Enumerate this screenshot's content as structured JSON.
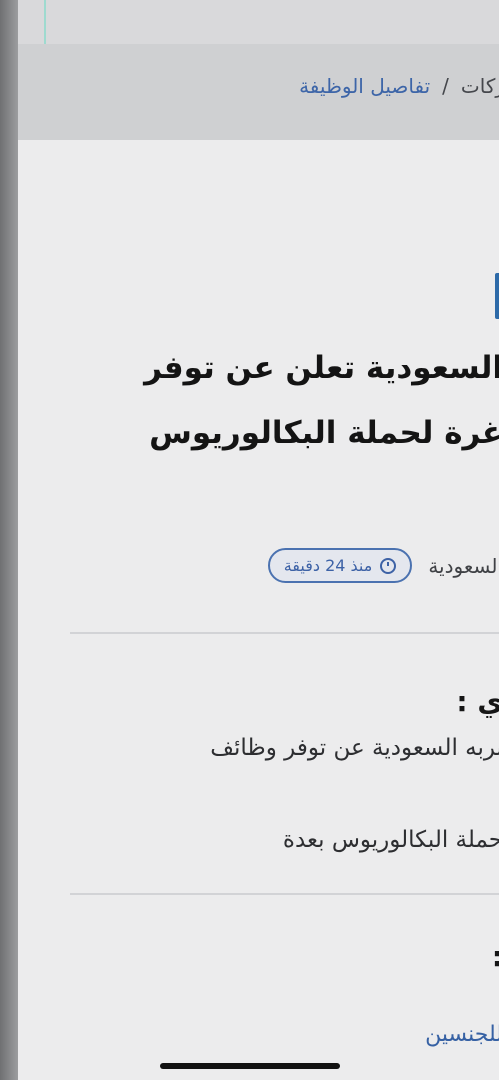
{
  "breadcrumb": {
    "previous": "ركات",
    "separator": "/",
    "current": "تفاصيل الوظيفة"
  },
  "job": {
    "title_line_1": "السعودية تعلن عن توفر",
    "title_line_2": "غرة لحملة البكالوريوس",
    "company": "السعودية",
    "posted": "منذ 24 دقيقة"
  },
  "description": {
    "heading": "ي :",
    "line_1": "بربه السعودية عن توفر وظائف",
    "line_2": "حملة البكالوريوس بعدة"
  },
  "requirements": {
    "heading": ":",
    "link": "للجنسين"
  }
}
